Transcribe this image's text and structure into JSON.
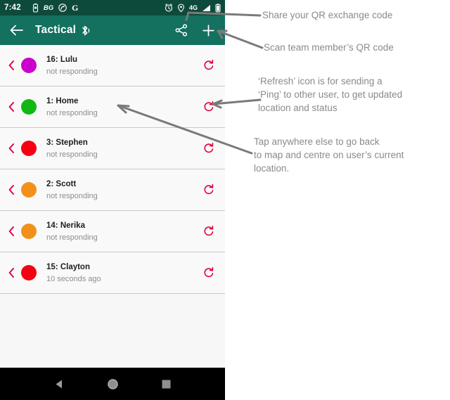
{
  "statusbar": {
    "clock": "7:42",
    "left_icons": [
      {
        "name": "vibrate-icon",
        "glyph": ""
      },
      {
        "name": "bg-badge-icon",
        "label": "BG"
      },
      {
        "name": "do-not-disturb-icon",
        "glyph": ""
      },
      {
        "name": "google-icon",
        "label": "G"
      }
    ],
    "right_icons": [
      {
        "name": "alarm-icon",
        "glyph": ""
      },
      {
        "name": "location-pin-icon",
        "glyph": ""
      },
      {
        "name": "network-type-label",
        "label": "4G"
      },
      {
        "name": "signal-bars-icon",
        "glyph": ""
      },
      {
        "name": "battery-icon",
        "glyph": ""
      }
    ]
  },
  "toolbar": {
    "back_label": "back",
    "title": "Tactical",
    "bluetooth_icon": "bluetooth-icon",
    "share_label": "share",
    "add_label": "add"
  },
  "list": {
    "rows": [
      {
        "name": "16: Lulu",
        "status": "not responding",
        "color": "#cc00cc"
      },
      {
        "name": "1: Home",
        "status": "not responding",
        "color": "#12b812"
      },
      {
        "name": "3: Stephen",
        "status": "not responding",
        "color": "#f60013"
      },
      {
        "name": "2: Scott",
        "status": "not responding",
        "color": "#f1911b"
      },
      {
        "name": "14: Nerika",
        "status": "not responding",
        "color": "#f1911b"
      },
      {
        "name": "15: Clayton",
        "status": "10 seconds ago",
        "color": "#f60013"
      }
    ],
    "chevron_icon": "chevron-left-icon",
    "refresh_icon": "refresh-icon"
  },
  "navbar": {
    "back": "back-triangle-icon",
    "home": "home-circle-icon",
    "recents": "recents-square-icon"
  },
  "annotations": {
    "share": "Share your QR exchange code",
    "scan": "Scan team member’s QR code",
    "refresh": "‘Refresh’ icon is for sending a\n‘Ping’ to other user, to get updated\nlocation and status",
    "tap": "Tap anywhere else to go back\nto map and centre on user’s current\nlocation."
  },
  "colors": {
    "toolbar": "#14705f",
    "statusbar": "#0e4a3c",
    "accent_red": "#e0003c",
    "annotation_text": "#8a8a8a",
    "leader_line": "#7a7a7a"
  }
}
